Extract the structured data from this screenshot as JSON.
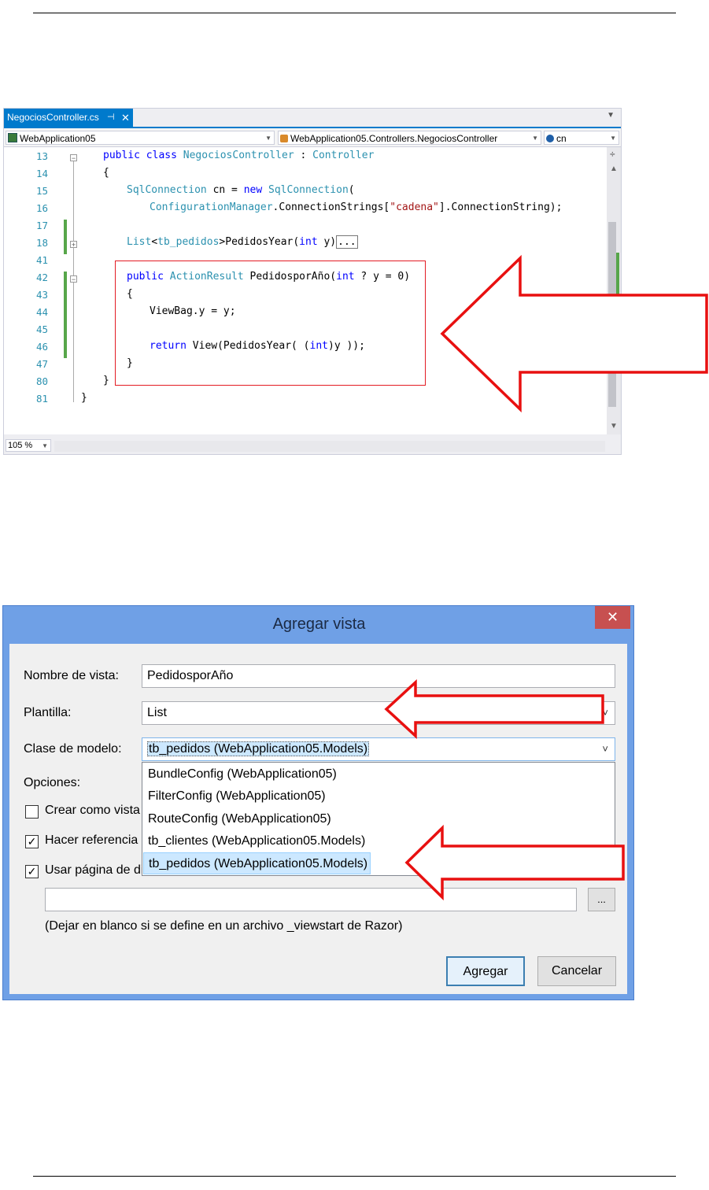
{
  "editor": {
    "tab_title": "NegociosController.cs",
    "tab_pin": "⊣",
    "tab_close": "✕",
    "project_combo": "WebApplication05",
    "class_combo": "WebApplication05.Controllers.NegociosController",
    "member_combo": "cn",
    "zoom": "105 %",
    "line_numbers": [
      "13",
      "14",
      "15",
      "16",
      "17",
      "18",
      "41",
      "42",
      "43",
      "44",
      "45",
      "46",
      "47",
      "80",
      "81"
    ],
    "code": {
      "l13_public": "public",
      "l13_class": "class",
      "l13_name": "NegociosController",
      "l13_colon": " : ",
      "l13_base": "Controller",
      "l14": "{",
      "l15_type": "SqlConnection",
      "l15_mid": " cn = ",
      "l15_new": "new",
      "l15_type2": "SqlConnection",
      "l15_end": "(",
      "l16_cm": "ConfigurationManager",
      "l16_mid": ".ConnectionStrings[",
      "l16_str": "\"cadena\"",
      "l16_end": "].ConnectionString);",
      "l18_list": "List",
      "l18_lt": "<",
      "l18_type": "tb_pedidos",
      "l18_gt": ">PedidosYear(",
      "l18_int": "int",
      "l18_y": " y)",
      "l18_collapsed": "...",
      "l42_public": "public",
      "l42_ar": "ActionResult",
      "l42_name": " PedidosporAño(",
      "l42_int": "int",
      "l42_rest": " ? y = 0)",
      "l43": "{",
      "l44": "ViewBag.y = y;",
      "l46_return": "return",
      "l46_view": " View(PedidosYear( (",
      "l46_int": "int",
      "l46_end": ")y ));",
      "l47": "}",
      "l80": "}",
      "l81": "}"
    }
  },
  "dialog": {
    "title": "Agregar vista",
    "close": "✕",
    "view_name_label": "Nombre de vista:",
    "view_name_value": "PedidosporAño",
    "template_label": "Plantilla:",
    "template_value": "List",
    "model_label": "Clase de modelo:",
    "model_value": "tb_pedidos (WebApplication05.Models)",
    "options_label": "Opciones:",
    "create_partial": "Crear como vista",
    "reference_libs": "Hacer referencia a",
    "use_layout": "Usar página de di",
    "dropdown_options": [
      "BundleConfig (WebApplication05)",
      "FilterConfig (WebApplication05)",
      "RouteConfig (WebApplication05)",
      "tb_clientes (WebApplication05.Models)",
      "tb_pedidos (WebApplication05.Models)"
    ],
    "selected_option": "tb_pedidos (WebApplication05.Models)",
    "layout_path_value": "",
    "browse_button": "...",
    "hint": "(Dejar en blanco si se define en un archivo _viewstart de Razor)",
    "add_button": "Agregar",
    "cancel_button": "Cancelar",
    "check_symbol": "✓"
  },
  "annotation_color": "#e81010"
}
